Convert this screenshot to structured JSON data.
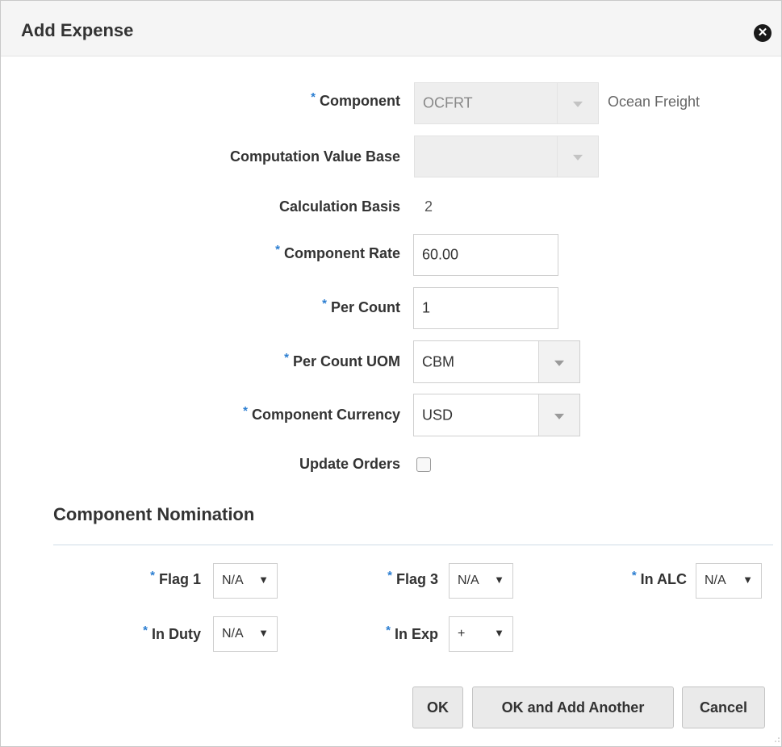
{
  "dialog": {
    "title": "Add Expense"
  },
  "form": {
    "component": {
      "label": "Component",
      "value": "OCFRT",
      "description": "Ocean Freight"
    },
    "computation_value_base": {
      "label": "Computation Value Base",
      "value": ""
    },
    "calculation_basis": {
      "label": "Calculation Basis",
      "value": "2"
    },
    "component_rate": {
      "label": "Component Rate",
      "value": "60.00"
    },
    "per_count": {
      "label": "Per Count",
      "value": "1"
    },
    "per_count_uom": {
      "label": "Per Count UOM",
      "value": "CBM"
    },
    "component_currency": {
      "label": "Component Currency",
      "value": "USD"
    },
    "update_orders": {
      "label": "Update Orders",
      "checked": false
    }
  },
  "nomination": {
    "title": "Component Nomination",
    "flag1": {
      "label": "Flag 1",
      "value": "N/A"
    },
    "flag3": {
      "label": "Flag 3",
      "value": "N/A"
    },
    "in_alc": {
      "label": "In ALC",
      "value": "N/A"
    },
    "in_duty": {
      "label": "In Duty",
      "value": "N/A"
    },
    "in_exp": {
      "label": "In Exp",
      "value": "+"
    }
  },
  "buttons": {
    "ok": "OK",
    "ok_add_another": "OK and Add Another",
    "cancel": "Cancel"
  },
  "required_marker": "*",
  "colors": {
    "required": "#2a7dd1",
    "header_bg": "#f5f5f5",
    "button_bg": "#eaeaea"
  }
}
